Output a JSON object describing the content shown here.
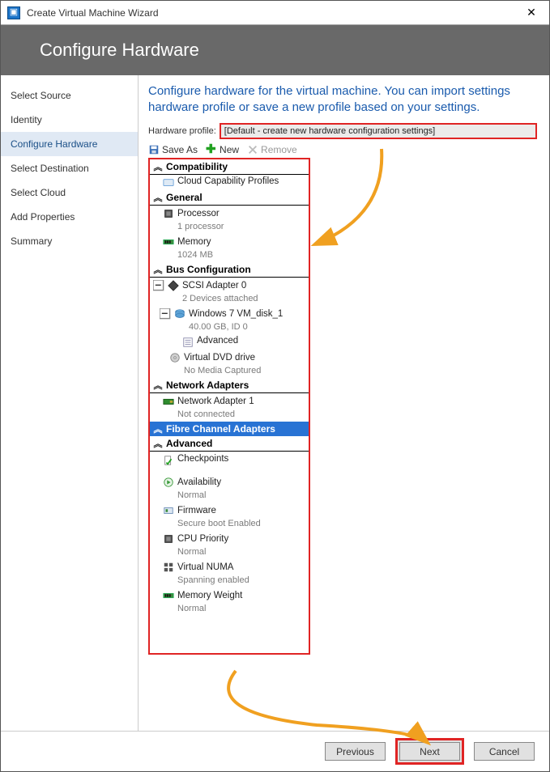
{
  "window": {
    "title": "Create Virtual Machine Wizard"
  },
  "banner": {
    "title": "Configure Hardware"
  },
  "sidebar": {
    "steps": [
      "Select Source",
      "Identity",
      "Configure Hardware",
      "Select Destination",
      "Select Cloud",
      "Add Properties",
      "Summary"
    ],
    "active_index": 2
  },
  "main": {
    "intro": "Configure hardware for the virtual machine. You can import settings hardware profile or save a new profile based on your settings.",
    "profile_label": "Hardware profile:",
    "profile_value": "[Default - create new hardware configuration settings]",
    "toolbar": {
      "save_as": "Save As",
      "new": "New",
      "remove": "Remove"
    },
    "tree": {
      "compatibility": {
        "title": "Compatibility",
        "cloud": "Cloud Capability Profiles"
      },
      "general": {
        "title": "General",
        "processor": {
          "label": "Processor",
          "sub": "1 processor"
        },
        "memory": {
          "label": "Memory",
          "sub": "1024 MB"
        }
      },
      "bus": {
        "title": "Bus Configuration",
        "scsi": {
          "label": "SCSI Adapter 0",
          "sub": "2 Devices attached"
        },
        "disk": {
          "label": "Windows 7 VM_disk_1",
          "sub": "40.00 GB, ID 0"
        },
        "advanced": "Advanced",
        "dvd": {
          "label": "Virtual DVD drive",
          "sub": "No Media Captured"
        }
      },
      "network": {
        "title": "Network Adapters",
        "adapter": {
          "label": "Network Adapter 1",
          "sub": "Not connected"
        }
      },
      "fibre": {
        "title": "Fibre Channel Adapters"
      },
      "advanced": {
        "title": "Advanced",
        "checkpoints": {
          "label": "Checkpoints",
          "sub": ""
        },
        "availability": {
          "label": "Availability",
          "sub": "Normal"
        },
        "firmware": {
          "label": "Firmware",
          "sub": "Secure boot Enabled"
        },
        "cpu": {
          "label": "CPU Priority",
          "sub": "Normal"
        },
        "numa": {
          "label": "Virtual NUMA",
          "sub": "Spanning enabled"
        },
        "memw": {
          "label": "Memory Weight",
          "sub": "Normal"
        }
      }
    }
  },
  "footer": {
    "previous": "Previous",
    "next": "Next",
    "cancel": "Cancel"
  }
}
